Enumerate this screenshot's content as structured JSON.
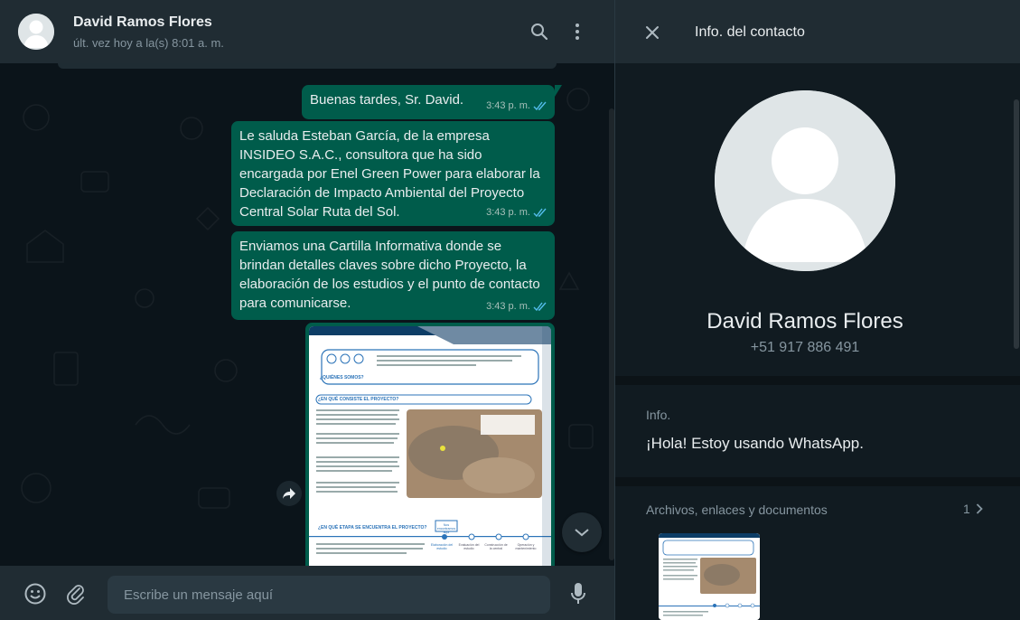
{
  "chat": {
    "contact_name": "David Ramos Flores",
    "last_seen": "últ. vez hoy a la(s) 8:01 a. m.",
    "icons": {
      "search": "search-icon",
      "menu": "kebab-menu-icon"
    },
    "messages": [
      {
        "text": "Buenas tardes, Sr. David.",
        "time": "3:43 p. m."
      },
      {
        "text": "Le saluda Esteban García, de la empresa INSIDEO S.A.C., consultora que ha sido encargada por Enel Green Power para elaborar la Declaración de Impacto Ambiental del Proyecto Central Solar Ruta del Sol.",
        "time": "3:43 p. m."
      },
      {
        "text": "Enviamos una Cartilla Informativa donde se brindan detalles claves sobre dicho Proyecto, la elaboración de los estudios y el punto de contacto para comunicarse.",
        "time": "3:43 p. m."
      }
    ],
    "document": {
      "heading1": "¿QUIÉNES SOMOS?",
      "heading2": "¿EN QUÉ CONSISTE EL PROYECTO?",
      "heading3": "¿EN QUÉ ETAPA SE ENCUENTRA EL PROYECTO?",
      "stage_label": "Nos encontramos aquí",
      "stages": [
        "Elaboración del estudio",
        "Evaluación del estudio",
        "Construcción de la central",
        "Operación y mantenimiento"
      ]
    },
    "composer": {
      "placeholder": "Escribe un mensaje aquí"
    },
    "colors": {
      "outgoing_bubble": "#005c4b",
      "header": "#202c33",
      "background": "#0b141a",
      "read_ticks": "#53bdeb"
    }
  },
  "info": {
    "title": "Info. del contacto",
    "name": "David Ramos Flores",
    "phone": "+51 917 886 491",
    "about_label": "Info.",
    "about_text": "¡Hola! Estoy usando WhatsApp.",
    "media_label": "Archivos, enlaces y documentos",
    "media_count": "1"
  }
}
